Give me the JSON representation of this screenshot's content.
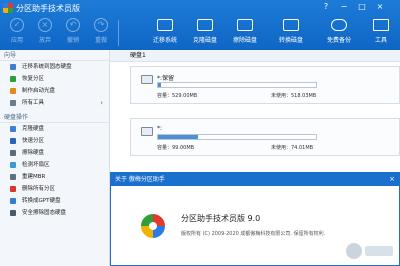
{
  "app": {
    "title": "分区助手技术员版"
  },
  "window_controls": {
    "help": "?",
    "minimize": "−",
    "maximize": "□",
    "close": "×"
  },
  "toolbar": {
    "apply": "应用",
    "discard": "放弃",
    "undo": "撤销",
    "redo": "重做",
    "migrate_os": "迁移系统",
    "clone_disk": "克隆磁盘",
    "wipe_disk": "擦除磁盘",
    "convert_disk": "转换磁盘",
    "free_backup": "免费备份",
    "tools": "工具"
  },
  "sidebar": {
    "wizard_header": "向导",
    "wizard_items": [
      "迁移系统到固态硬盘",
      "恢复分区",
      "制作启动光盘",
      "所有工具"
    ],
    "disk_header": "硬盘操作",
    "disk_items": [
      "克隆硬盘",
      "快速分区",
      "擦除硬盘",
      "检测坏扇区",
      "重建MBR",
      "删除所有分区",
      "转换成GPT硬盘",
      "安全擦除固态硬盘"
    ]
  },
  "main": {
    "disk_label": "硬盘1",
    "partitions": [
      {
        "name": "*:保留",
        "capacity_label": "容量：529.00MB",
        "unused_label": "未使用：518.03MB",
        "used_fraction": 0.02
      },
      {
        "name": "*:",
        "capacity_label": "容量：99.00MB",
        "unused_label": "未使用：74.01MB",
        "used_fraction": 0.25
      }
    ]
  },
  "about_dialog": {
    "title": "关于 傲梅分区助手",
    "close": "×",
    "product_name": "分区助手技术员版 9.0",
    "copyright": "版权所有 (C) 2009-2020 成都傲梅科技有限公司. 保留所有权利."
  },
  "colors": {
    "titlebar": "#1568c7",
    "accent": "#4f8fd8",
    "panel": "#f3f6fa"
  }
}
